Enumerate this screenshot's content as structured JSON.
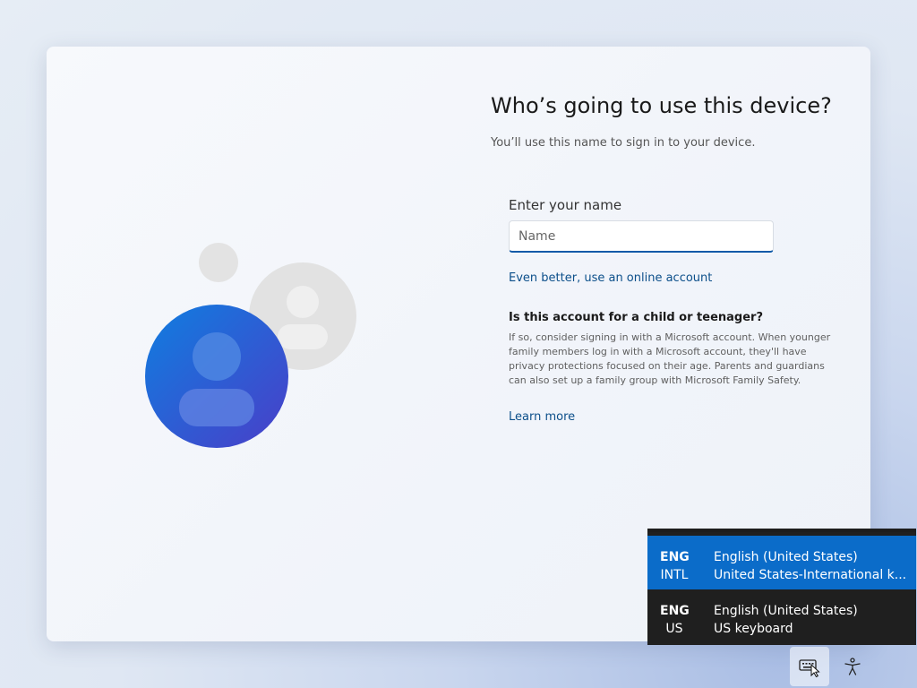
{
  "page": {
    "title": "Who’s going to use this device?",
    "subtitle": "You’ll use this name to sign in to your device."
  },
  "form": {
    "name_label": "Enter your name",
    "name_placeholder": "Name",
    "name_value": "",
    "online_account_link": "Even better, use an online account"
  },
  "child_section": {
    "heading": "Is this account for a child or teenager?",
    "body": "If so, consider signing in with a Microsoft account. When younger family members log in with a Microsoft account, they'll have privacy protections focused on their age. Parents and guardians can also set up a family group with Microsoft Family Safety.",
    "learn_more": "Learn more"
  },
  "language_popup": {
    "items": [
      {
        "code": "ENG",
        "sub": "INTL",
        "language": "English (United States)",
        "keyboard": "United States-International k...",
        "selected": true
      },
      {
        "code": "ENG",
        "sub": "US",
        "language": "English (United States)",
        "keyboard": "US keyboard",
        "selected": false
      }
    ]
  },
  "tray": {
    "keyboard_icon": "keyboard-icon",
    "accessibility_icon": "accessibility-icon"
  },
  "colors": {
    "accent": "#0b6cc9",
    "link": "#0c4f8a",
    "popup_bg": "#202020",
    "avatar_blue": "#1f63d6"
  }
}
